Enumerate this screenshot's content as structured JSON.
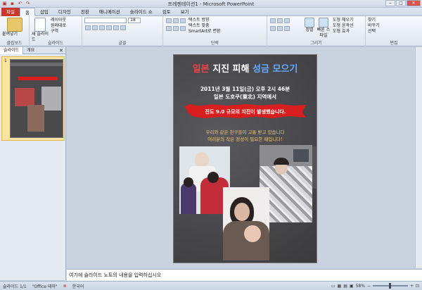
{
  "window": {
    "title": "프레젠테이션1 - Microsoft PowerPoint",
    "qat": [
      "save-icon",
      "undo-icon",
      "redo-icon"
    ]
  },
  "tabs": [
    "파일",
    "홈",
    "삽입",
    "디자인",
    "전환",
    "애니메이션",
    "슬라이드 쇼",
    "검토",
    "보기"
  ],
  "ribbon": {
    "clipboard": {
      "paste": "붙여넣기",
      "label": "클립보드"
    },
    "slides": {
      "new_slide": "새 슬라이드",
      "layout": "레이아웃",
      "reset": "원래대로",
      "section": "구역",
      "label": "슬라이드"
    },
    "font": {
      "size": "18",
      "label": "글꼴"
    },
    "paragraph": {
      "text_direction": "텍스트 방향",
      "align_text": "텍스트 맞춤",
      "smartart": "SmartArt로 변환",
      "label": "단락"
    },
    "drawing": {
      "arrange": "정렬",
      "quick_styles": "빠른 스타일",
      "fill": "도형 채우기",
      "outline": "도형 윤곽선",
      "effects": "도형 효과",
      "label": "그리기"
    },
    "editing": {
      "find": "찾기",
      "replace": "바꾸기",
      "select": "선택",
      "label": "편집"
    }
  },
  "pane": {
    "tab_slides": "슬라이드",
    "tab_outline": "개요",
    "thumb_number": "1"
  },
  "slide": {
    "title_part1": "일본",
    "title_part2": " 지진 피해 ",
    "title_part3": "성금 모으기",
    "date": "2011년 3월 11일(금) 오후 2시 46분",
    "place": "일본 도호쿠(東北) 지역에서",
    "banner": "진도 9.0 규모의 지진이 발생했습니다.",
    "message1": "우리와 같은 친구들이 고통 받고 있습니다",
    "message2": "여러분의 작은 정성이 필요한 때입니다!"
  },
  "notes": {
    "placeholder": "여기에 슬라이드 노트의 내용을 입력하십시오"
  },
  "status": {
    "slide_pos": "슬라이드 1/1",
    "theme": "\"Office 테마\"",
    "language": "한국어",
    "zoom": "58%",
    "zoom_fraction": 0.5
  },
  "colors": {
    "file_tab": "#c8392b",
    "banner_red": "#d81e1e",
    "title_red": "#e44",
    "title_blue": "#6af",
    "message_gold": "#f3c36a"
  }
}
